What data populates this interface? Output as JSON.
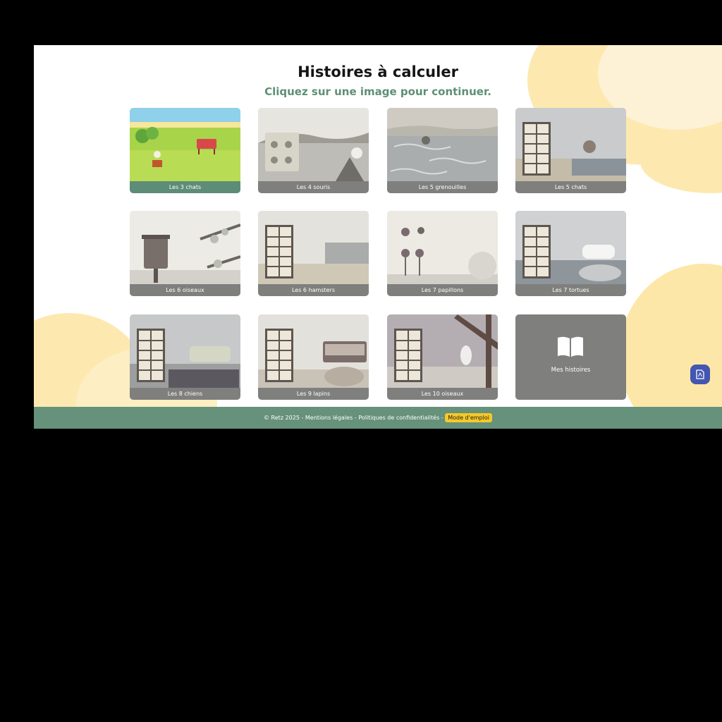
{
  "header": {
    "title": "Histoires à calculer",
    "subtitle": "Cliquez sur une image pour continuer."
  },
  "cards": [
    {
      "label": "Les 3 chats"
    },
    {
      "label": "Les 4 souris"
    },
    {
      "label": "Les 5 grenouilles"
    },
    {
      "label": "Les 5 chats"
    },
    {
      "label": "Les 6 oiseaux"
    },
    {
      "label": "Les 6 hamsters"
    },
    {
      "label": "Les 7 papillons"
    },
    {
      "label": "Les 7 tortues"
    },
    {
      "label": "Les 8 chiens"
    },
    {
      "label": "Les 9 lapins"
    },
    {
      "label": "Les 10 oiseaux"
    }
  ],
  "mes_histoires": {
    "label": "Mes histoires",
    "icon": "open-book-icon"
  },
  "footer": {
    "copyright": "© Retz 2025",
    "sep1": " - ",
    "mentions": "Mentions légales",
    "sep2": " - ",
    "politiques": "Politiques de confidentialités",
    "sep3": " - ",
    "mode": "Mode d'emploi"
  },
  "pdf_button": {
    "icon": "pdf-file-icon"
  },
  "colors": {
    "accent_green": "#66917a",
    "subtitle_green": "#5e8f76",
    "card_label_gray": "#7f7f7d",
    "highlight_yellow": "#f5c928",
    "pdf_blue": "#4356b1",
    "blob_yellow": "#fde9b0"
  }
}
